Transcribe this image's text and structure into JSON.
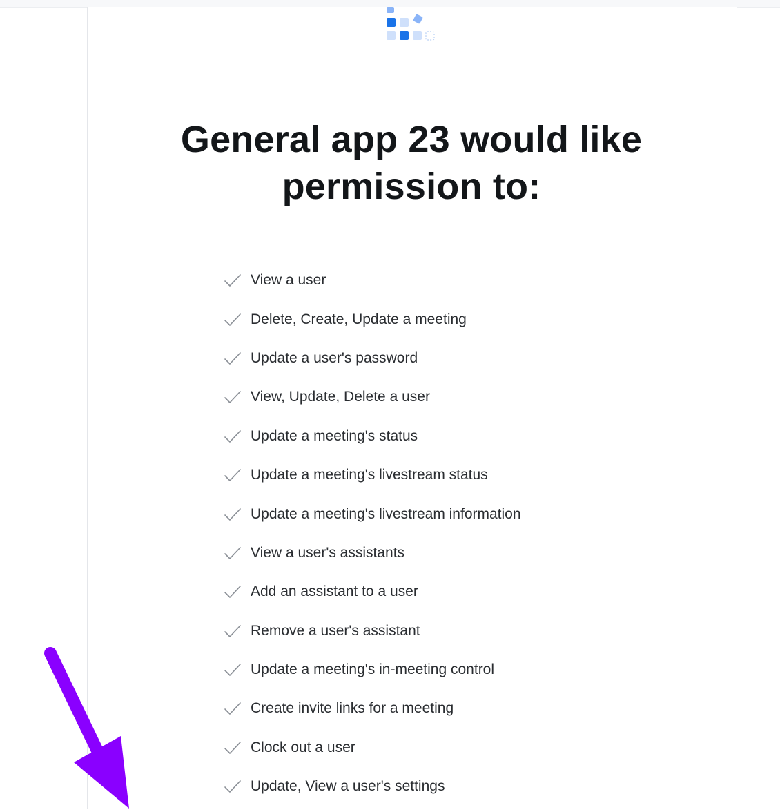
{
  "consent": {
    "title": "General app 23 would like permission to:",
    "permissions": [
      "View a user",
      "Delete, Create, Update a meeting",
      "Update a user's password",
      "View, Update, Delete a user",
      "Update a meeting's status",
      "Update a meeting's livestream status",
      "Update a meeting's livestream information",
      "View a user's assistants",
      "Add an assistant to a user",
      "Remove a user's assistant",
      "Update a meeting's in-meeting control",
      "Create invite links for a meeting",
      "Clock out a user",
      "Update, View a user's settings"
    ]
  },
  "icons": {
    "logo": "app-logo-icon",
    "check": "checkmark-icon",
    "annotation": "arrow-pointer-icon"
  },
  "colors": {
    "logo_dark": "#1a73e8",
    "logo_mid": "#8ab4f8",
    "logo_light": "#cfe0fb",
    "check": "#8a8f96",
    "annotation_arrow": "#8a00ff"
  }
}
